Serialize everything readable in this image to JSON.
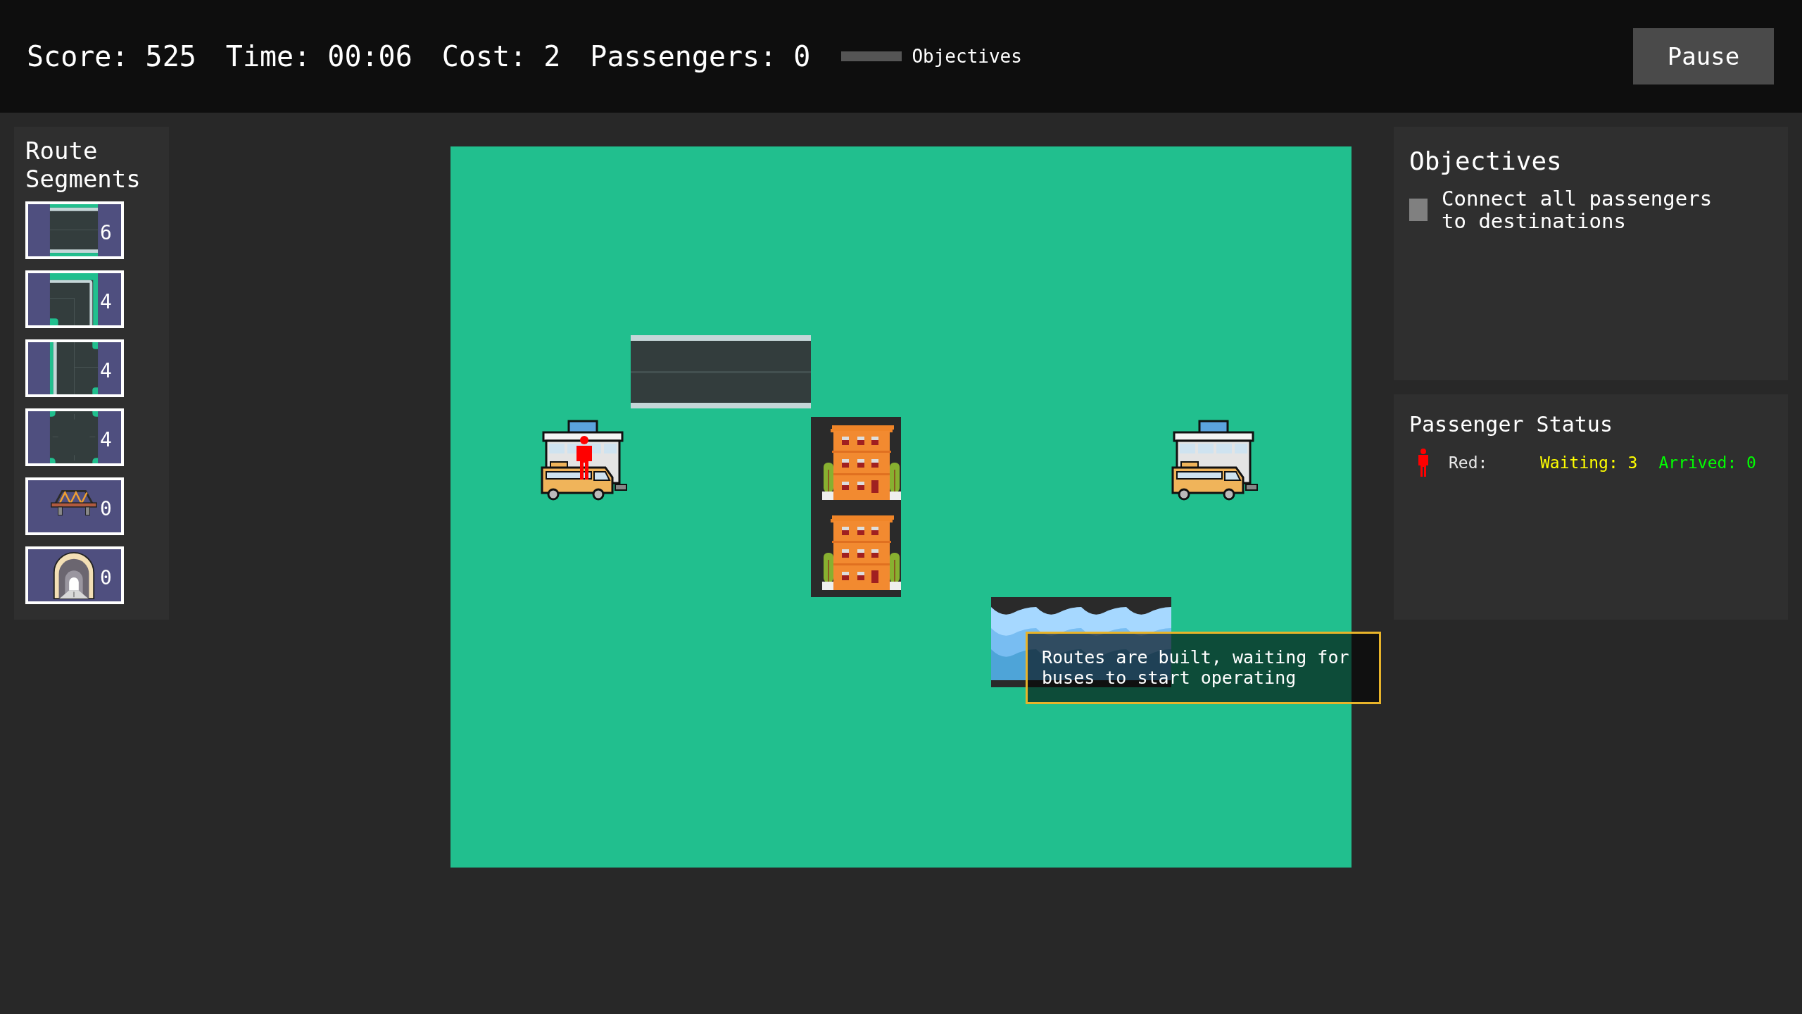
{
  "hud": {
    "stats": [
      "Score: 525",
      "Time: 00:06",
      "Cost: 2",
      "Passengers: 0"
    ],
    "objectives_toggle": "Objectives",
    "pause_button": "Pause"
  },
  "route_segments": {
    "title": "Route Segments",
    "items": [
      {
        "kind": "straight",
        "count": "6"
      },
      {
        "kind": "corner",
        "count": "4"
      },
      {
        "kind": "t_junction",
        "count": "4"
      },
      {
        "kind": "crossing",
        "count": "4"
      },
      {
        "kind": "bridge",
        "count": "0"
      },
      {
        "kind": "tunnel",
        "count": "0"
      }
    ]
  },
  "map": {
    "tiles": [
      {
        "kind": "road"
      },
      {
        "kind": "station",
        "passenger": true
      },
      {
        "kind": "buildings"
      },
      {
        "kind": "station",
        "passenger": false
      },
      {
        "kind": "water"
      }
    ],
    "tooltip": "Routes are built, waiting for buses to start operating"
  },
  "objectives": {
    "title": "Objectives",
    "items": [
      {
        "text": "Connect all passengers to destinations",
        "done": false
      }
    ]
  },
  "passenger_status": {
    "title": "Passenger Status",
    "rows": [
      {
        "color": "#ff0000",
        "label": "Red:",
        "waiting": "Waiting: 3",
        "arrived": "Arrived: 0"
      }
    ]
  }
}
